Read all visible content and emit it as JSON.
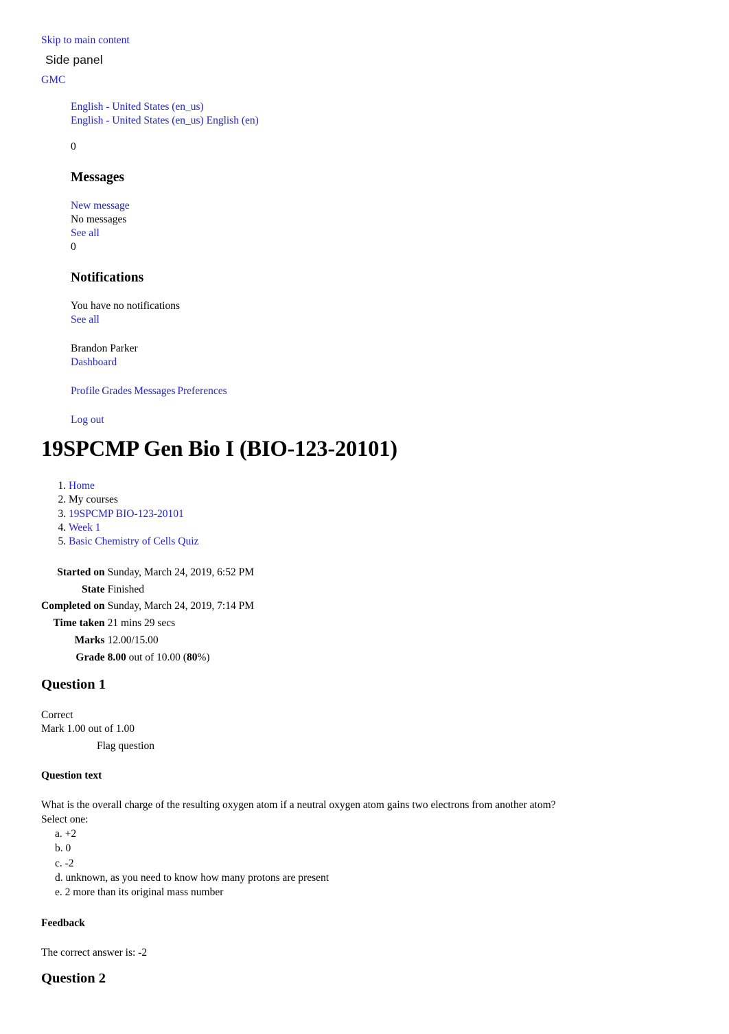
{
  "colors": {
    "link": "#2323dc",
    "text": "#000000",
    "background": "#ffffff"
  },
  "skip_link": "Skip to main content",
  "side_panel": {
    "title": "Side panel",
    "brand": "GMC",
    "language_current": "English - United States (en_us)",
    "language_options": "English - United States (en_us) English (en)",
    "messages": {
      "count_badge": "0",
      "heading": "Messages",
      "new_message_link": "New message",
      "empty_text": "No messages",
      "see_all_link": "See all"
    },
    "notifications": {
      "count_badge": "0",
      "heading": "Notifications",
      "empty_text": "You have no notifications",
      "see_all_link": "See all"
    },
    "user": {
      "name": "Brandon Parker",
      "dashboard_link": "Dashboard",
      "menu": [
        "Profile",
        "Grades",
        "Messages",
        "Preferences"
      ],
      "logout_link": "Log out"
    }
  },
  "course": {
    "title": "19SPCMP Gen Bio I (BIO-123-20101)"
  },
  "breadcrumb": [
    {
      "label": "Home",
      "is_link": true
    },
    {
      "label": "My  courses",
      "is_link": false
    },
    {
      "label": "19SPCMP BIO-123-20101",
      "is_link": true
    },
    {
      "label": "Week 1",
      "is_link": true
    },
    {
      "label": "Basic Chemistry of Cells Quiz",
      "is_link": true
    }
  ],
  "attempt_summary": {
    "rows": [
      {
        "label": "Started on",
        "value": "Sunday, March 24, 2019, 6:52 PM"
      },
      {
        "label": "State",
        "value": "Finished"
      },
      {
        "label": "Completed on",
        "value": "Sunday, March 24, 2019, 7:14 PM"
      },
      {
        "label": "Time taken",
        "value": "21 mins 29 secs"
      },
      {
        "label": "Marks",
        "value": "12.00/15.00"
      }
    ],
    "grade_label": "Grade",
    "grade_value_bold": "8.00",
    "grade_value_mid": " out of 10.00 (",
    "grade_percent_bold": "80",
    "grade_value_end": "%)"
  },
  "question1": {
    "heading": "Question 1",
    "state": "Correct",
    "mark": "Mark 1.00 out of 1.00",
    "flag_label": "Flag question",
    "question_text_label": "Question text",
    "text": "What is the overall charge of the resulting oxygen atom if a neutral oxygen atom gains two electrons from another atom?",
    "select_one": "Select one:",
    "options": [
      "a. +2",
      "b. 0",
      "c. -2",
      "d. unknown, as you need to know how many protons are present",
      "e. 2 more than its original mass number"
    ],
    "feedback_label": "Feedback",
    "feedback_text": "The correct answer is: -2"
  },
  "question2": {
    "heading": "Question 2"
  }
}
